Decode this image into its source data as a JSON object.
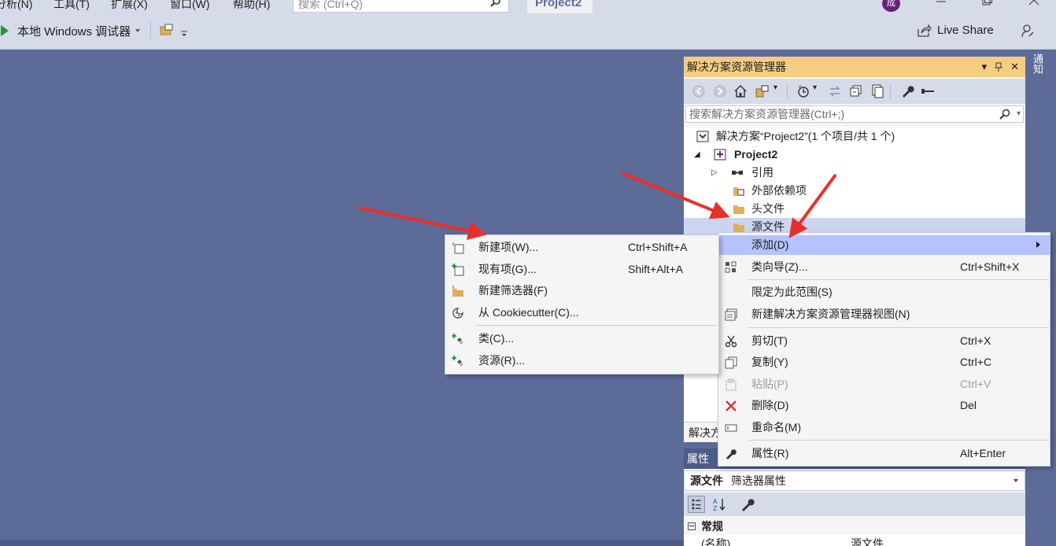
{
  "menu": {
    "analyze": "分析(N)",
    "tools": "工具(T)",
    "extensions": "扩展(X)",
    "window": "窗口(W)",
    "help": "帮助(H)"
  },
  "search": {
    "placeholder": "搜索 (Ctrl+Q)"
  },
  "project_title": "Project2",
  "user_avatar": "成",
  "toolbar": {
    "run_label": "本地 Windows 调试器",
    "live_share": "Live Share"
  },
  "solution_explorer": {
    "title": "解决方案资源管理器",
    "search_placeholder": "搜索解决方案资源管理器(Ctrl+;)",
    "tree": {
      "solution": "解决方案“Project2”(1 个项目/共 1 个)",
      "project": "Project2",
      "references": "引用",
      "external_deps": "外部依赖项",
      "header_files": "头文件",
      "source_files": "源文件"
    },
    "footer_label": "解决方"
  },
  "side_tab": "通知",
  "properties": {
    "title": "属性",
    "object_name": "源文件",
    "object_type": "筛选器属性",
    "section": "常规",
    "row_name": "(名称)",
    "row_value": "源文件"
  },
  "context_menu": {
    "items": [
      {
        "label": "添加(D)",
        "shortcut": ""
      },
      {
        "label": "类向导(Z)...",
        "shortcut": "Ctrl+Shift+X"
      },
      {
        "label": "限定为此范围(S)",
        "shortcut": ""
      },
      {
        "label": "新建解决方案资源管理器视图(N)",
        "shortcut": ""
      },
      {
        "label": "剪切(T)",
        "shortcut": "Ctrl+X"
      },
      {
        "label": "复制(Y)",
        "shortcut": "Ctrl+C"
      },
      {
        "label": "粘贴(P)",
        "shortcut": "Ctrl+V"
      },
      {
        "label": "删除(D)",
        "shortcut": "Del"
      },
      {
        "label": "重命名(M)",
        "shortcut": ""
      },
      {
        "label": "属性(R)",
        "shortcut": "Alt+Enter"
      }
    ]
  },
  "submenu": {
    "items": [
      {
        "label": "新建项(W)...",
        "shortcut": "Ctrl+Shift+A"
      },
      {
        "label": "现有项(G)...",
        "shortcut": "Shift+Alt+A"
      },
      {
        "label": "新建筛选器(F)",
        "shortcut": ""
      },
      {
        "label": "从 Cookiecutter(C)...",
        "shortcut": ""
      },
      {
        "label": "类(C)...",
        "shortcut": ""
      },
      {
        "label": "资源(R)...",
        "shortcut": ""
      }
    ]
  },
  "colors": {
    "editor_bg": "#5d6b99",
    "panel_header_active": "#f5cc84",
    "highlight": "#b4c3ff",
    "annotation_arrow": "#e8302a"
  }
}
